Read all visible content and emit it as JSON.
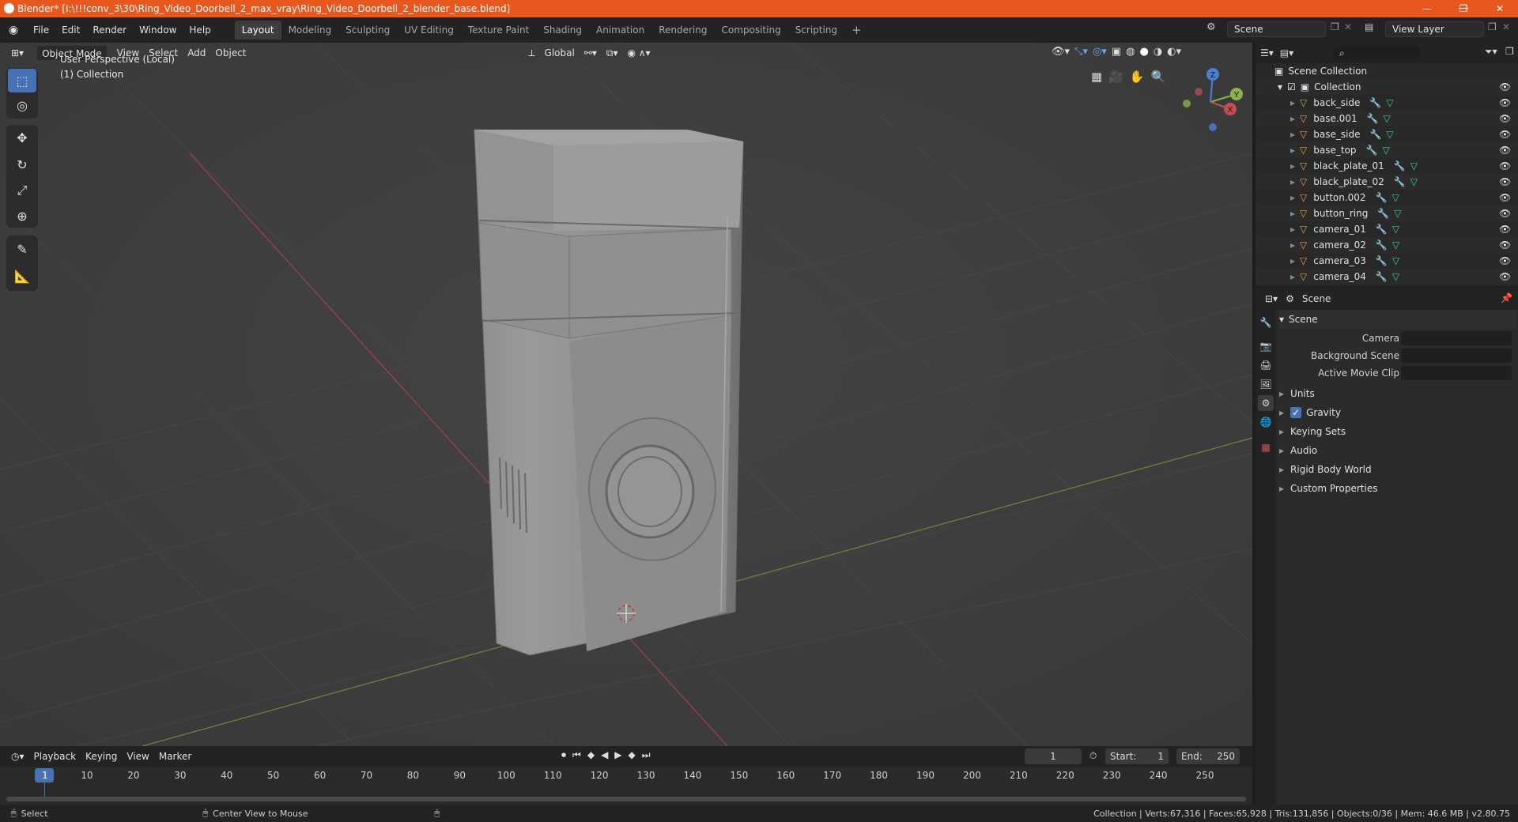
{
  "window": {
    "title": "Blender* [I:\\!!!conv_3\\30\\Ring_Video_Doorbell_2_max_vray\\Ring_Video_Doorbell_2_blender_base.blend]",
    "minimize": "—",
    "maximize": "❐",
    "close": "✕"
  },
  "menus": [
    "File",
    "Edit",
    "Render",
    "Window",
    "Help"
  ],
  "workspaces": [
    "Layout",
    "Modeling",
    "Sculpting",
    "UV Editing",
    "Texture Paint",
    "Shading",
    "Animation",
    "Rendering",
    "Compositing",
    "Scripting"
  ],
  "add_workspace": "+",
  "scene_selector": "Scene",
  "view_layer_selector": "View Layer",
  "viewport": {
    "mode": "Object Mode",
    "menus": [
      "View",
      "Select",
      "Add",
      "Object"
    ],
    "transform_orientation": "Global",
    "overlay_text_1": "User Perspective (Local)",
    "overlay_text_2": "(1) Collection",
    "gizmo_axes": {
      "z": "Z",
      "y": "Y",
      "x": "X"
    }
  },
  "outliner": {
    "root": "Scene Collection",
    "collection": "Collection",
    "items": [
      "back_side",
      "base.001",
      "base_side",
      "base_top",
      "black_plate_01",
      "black_plate_02",
      "button.002",
      "button_ring",
      "camera_01",
      "camera_02",
      "camera_03",
      "camera_04"
    ]
  },
  "properties": {
    "context": "Scene",
    "panel_title": "Scene",
    "fields": [
      {
        "label": "Camera"
      },
      {
        "label": "Background Scene"
      },
      {
        "label": "Active Movie Clip"
      }
    ],
    "subpanels": [
      "Units",
      "Gravity",
      "Keying Sets",
      "Audio",
      "Rigid Body World",
      "Custom Properties"
    ]
  },
  "timeline": {
    "menus": [
      "Playback",
      "Keying",
      "View",
      "Marker"
    ],
    "current_frame": "1",
    "start_label": "Start:",
    "start": "1",
    "end_label": "End:",
    "end": "250",
    "ruler": [
      "1",
      "10",
      "20",
      "30",
      "40",
      "50",
      "60",
      "70",
      "80",
      "90",
      "100",
      "110",
      "120",
      "130",
      "140",
      "150",
      "160",
      "170",
      "180",
      "190",
      "200",
      "210",
      "220",
      "230",
      "240",
      "250"
    ]
  },
  "status": {
    "left_action": "Select",
    "middle_action": "Center View to Mouse",
    "stats": "Collection | Verts:67,316 | Faces:65,928 | Tris:131,856 | Objects:0/36 | Mem: 46.6 MB | v2.80.75"
  },
  "colors": {
    "titlebar": "#e8571e",
    "accent": "#4772b3",
    "x_axis": "#c44d55",
    "y_axis": "#8ab34a",
    "z_axis": "#4a7fd1",
    "object_icon": "#e8a04a",
    "mesh_icon": "#3ac7b2"
  }
}
